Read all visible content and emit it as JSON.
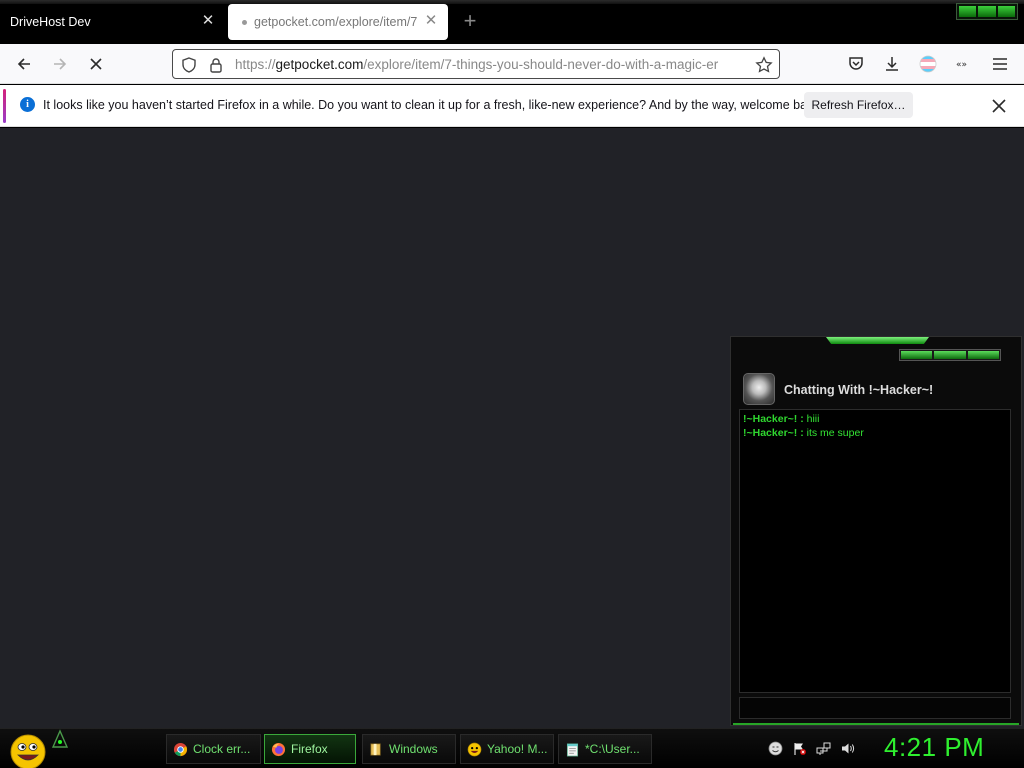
{
  "browser": {
    "tabs": [
      {
        "label": "DriveHost Dev",
        "active": false
      },
      {
        "label": "getpocket.com/explore/item/7",
        "active": true
      }
    ],
    "url": {
      "prefix": "https://",
      "host": "getpocket.com",
      "path": "/explore/item/7-things-you-should-never-do-with-a-magic-er"
    },
    "notification": {
      "message": "It looks like you haven’t started Firefox in a while. Do you want to clean it up for a fresh, like-new experience? And by the way, welcome back!",
      "button": "Refresh Firefox…"
    }
  },
  "chat": {
    "title": "Chatting With !~Hacker~!",
    "messages": [
      {
        "sender": "!~Hacker~! :",
        "text": "hiii"
      },
      {
        "sender": "!~Hacker~! :",
        "text": "its me super"
      }
    ]
  },
  "taskbar": {
    "items": [
      {
        "label": "Clock err...",
        "icon": "chrome-icon"
      },
      {
        "label": "Firefox",
        "icon": "firefox-icon",
        "active": true
      },
      {
        "label": "Windows",
        "icon": "folder-icon"
      },
      {
        "label": "Yahoo! M...",
        "icon": "yahoo-messenger-icon"
      },
      {
        "label": "*C:\\User...",
        "icon": "notepad-icon"
      }
    ],
    "clock": "4:21 PM"
  },
  "colors": {
    "accent_green": "#2ff02f",
    "content_bg": "#212227",
    "info_blue": "#0a6fd6"
  }
}
